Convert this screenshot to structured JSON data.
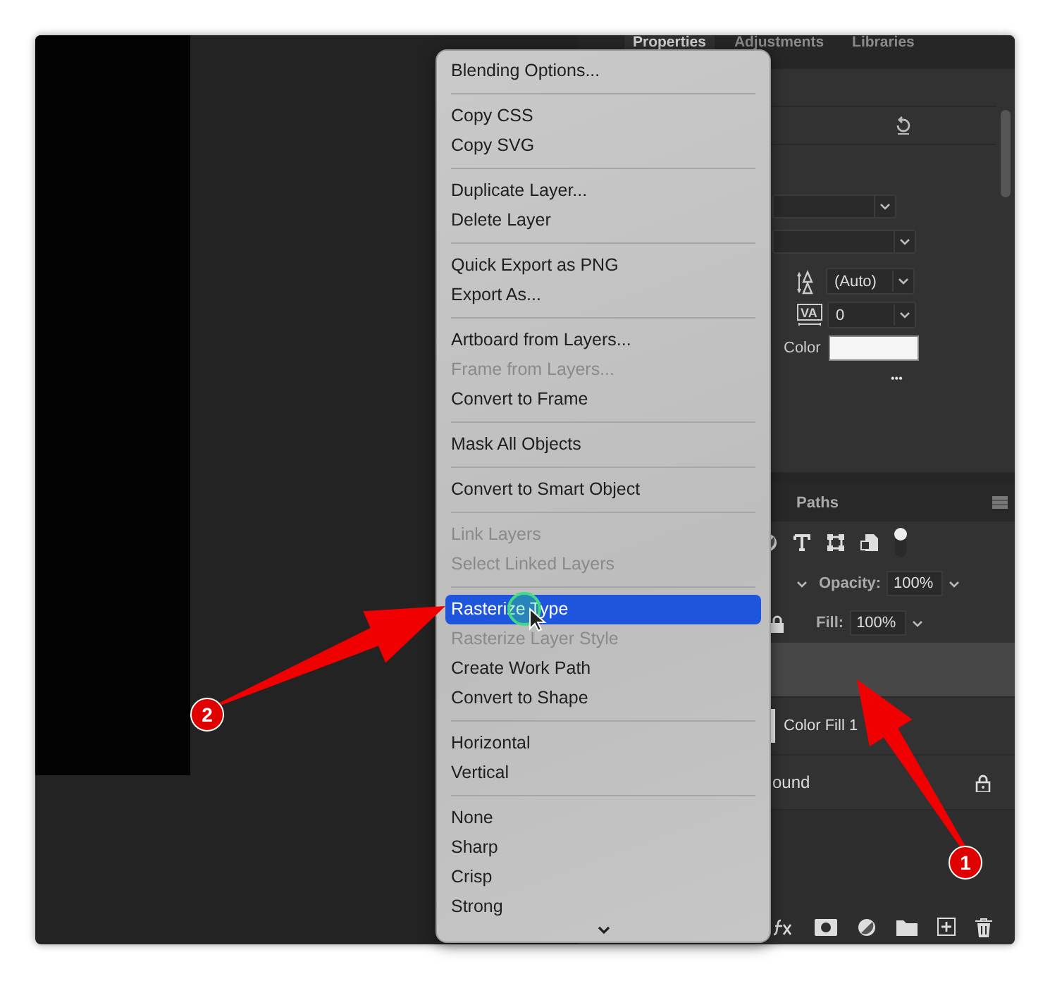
{
  "panel_tabs": [
    {
      "label": "Properties",
      "selected": true
    },
    {
      "label": "Adjustments",
      "selected": false
    },
    {
      "label": "Libraries",
      "selected": false
    }
  ],
  "properties": {
    "leading": "(Auto)",
    "tracking_icon": "VA",
    "tracking": "0",
    "color_label": "Color",
    "more": "•••"
  },
  "layers_panel": {
    "tab": "Paths",
    "opacity_label": "Opacity:",
    "opacity": "100%",
    "fill_label": "Fill:",
    "fill": "100%",
    "layers": [
      {
        "selected": true,
        "locked": false
      },
      {
        "name": "Color Fill 1",
        "selected": false,
        "locked": false
      },
      {
        "name": "ound",
        "selected": false,
        "locked": true
      }
    ]
  },
  "context_menu": {
    "groups": [
      {
        "items": [
          {
            "label": "Blending Options...",
            "disabled": false,
            "selected": false
          }
        ]
      },
      {
        "items": [
          {
            "label": "Copy CSS",
            "disabled": false,
            "selected": false
          },
          {
            "label": "Copy SVG",
            "disabled": false,
            "selected": false
          }
        ]
      },
      {
        "items": [
          {
            "label": "Duplicate Layer...",
            "disabled": false,
            "selected": false
          },
          {
            "label": "Delete Layer",
            "disabled": false,
            "selected": false
          }
        ]
      },
      {
        "items": [
          {
            "label": "Quick Export as PNG",
            "disabled": false,
            "selected": false
          },
          {
            "label": "Export As...",
            "disabled": false,
            "selected": false
          }
        ]
      },
      {
        "items": [
          {
            "label": "Artboard from Layers...",
            "disabled": false,
            "selected": false
          },
          {
            "label": "Frame from Layers...",
            "disabled": true,
            "selected": false
          },
          {
            "label": "Convert to Frame",
            "disabled": false,
            "selected": false
          }
        ]
      },
      {
        "items": [
          {
            "label": "Mask All Objects",
            "disabled": false,
            "selected": false
          }
        ]
      },
      {
        "items": [
          {
            "label": "Convert to Smart Object",
            "disabled": false,
            "selected": false
          }
        ]
      },
      {
        "items": [
          {
            "label": "Link Layers",
            "disabled": true,
            "selected": false
          },
          {
            "label": "Select Linked Layers",
            "disabled": true,
            "selected": false
          }
        ]
      },
      {
        "items": [
          {
            "label": "Rasterize Type",
            "disabled": false,
            "selected": true
          },
          {
            "label": "Rasterize Layer Style",
            "disabled": true,
            "selected": false
          },
          {
            "label": "Create Work Path",
            "disabled": false,
            "selected": false
          },
          {
            "label": "Convert to Shape",
            "disabled": false,
            "selected": false
          }
        ]
      },
      {
        "items": [
          {
            "label": "Horizontal",
            "disabled": false,
            "selected": false
          },
          {
            "label": "Vertical",
            "disabled": false,
            "selected": false
          }
        ]
      },
      {
        "items": [
          {
            "label": "None",
            "disabled": false,
            "selected": false
          },
          {
            "label": "Sharp",
            "disabled": false,
            "selected": false
          },
          {
            "label": "Crisp",
            "disabled": false,
            "selected": false
          },
          {
            "label": "Strong",
            "disabled": false,
            "selected": false
          }
        ]
      }
    ]
  },
  "callouts": [
    {
      "label": "1"
    },
    {
      "label": "2"
    }
  ]
}
